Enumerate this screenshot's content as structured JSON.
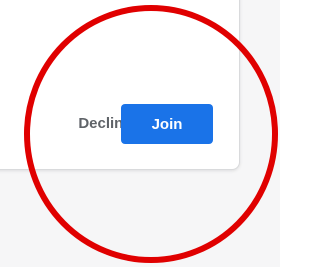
{
  "dialog": {
    "decline_label": "Decline",
    "join_label": "Join"
  },
  "colors": {
    "join_background": "#1a73e8",
    "join_text": "#ffffff",
    "decline_text": "#5f6368",
    "highlight_ring": "#e00000"
  }
}
